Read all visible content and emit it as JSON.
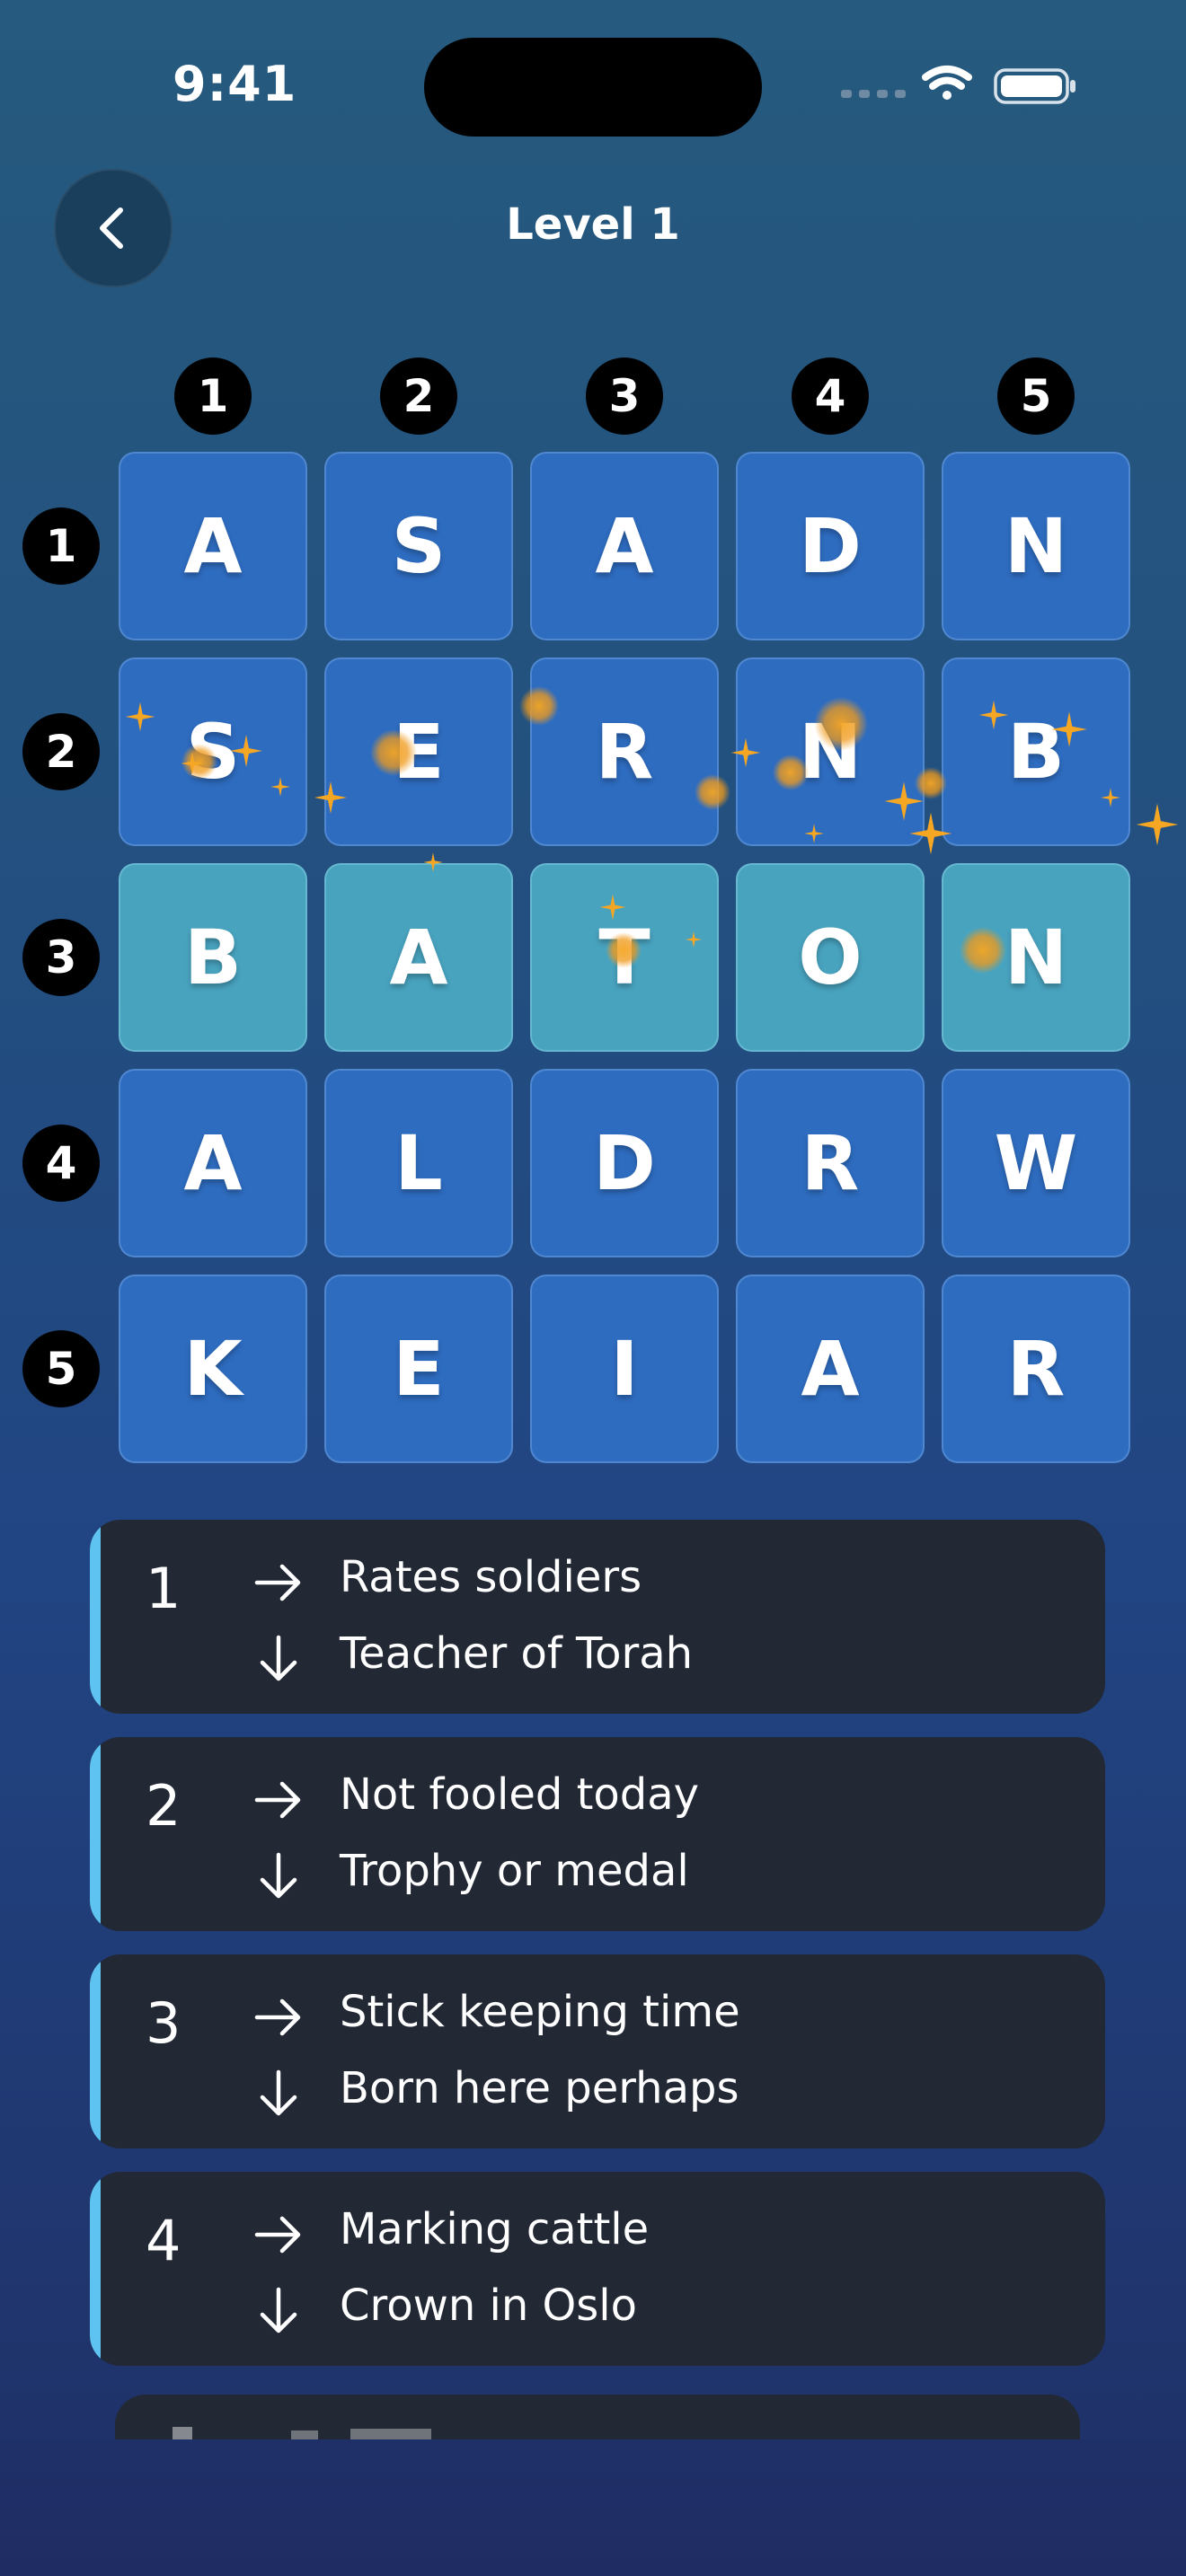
{
  "status": {
    "time": "9:41"
  },
  "header": {
    "title": "Level 1"
  },
  "grid": {
    "column_numbers": [
      "1",
      "2",
      "3",
      "4",
      "5"
    ],
    "row_numbers": [
      "1",
      "2",
      "3",
      "4",
      "5"
    ],
    "rows": [
      [
        "A",
        "S",
        "A",
        "D",
        "N"
      ],
      [
        "S",
        "E",
        "R",
        "N",
        "B"
      ],
      [
        "B",
        "A",
        "T",
        "O",
        "N"
      ],
      [
        "A",
        "L",
        "D",
        "R",
        "W"
      ],
      [
        "K",
        "E",
        "I",
        "A",
        "R"
      ]
    ],
    "highlighted_row": 3
  },
  "clues": [
    {
      "number": "1",
      "across": "Rates soldiers",
      "down": "Teacher of Torah"
    },
    {
      "number": "2",
      "across": "Not fooled today",
      "down": "Trophy or medal"
    },
    {
      "number": "3",
      "across": "Stick keeping time",
      "down": "Born here perhaps"
    },
    {
      "number": "4",
      "across": "Marking cattle",
      "down": "Crown in Oslo"
    }
  ],
  "icons": {
    "back": "chevron-left-icon",
    "across": "arrow-right-icon",
    "down": "arrow-down-icon",
    "signal": "cellular-signal-icon",
    "wifi": "wifi-icon",
    "battery": "battery-icon"
  },
  "colors": {
    "cell": "#2e6cc0",
    "highlight_cell": "#48a3bf",
    "clue_card": "#222834",
    "clue_accent": "#5ec3f0",
    "sparkle": "#f5a623"
  }
}
